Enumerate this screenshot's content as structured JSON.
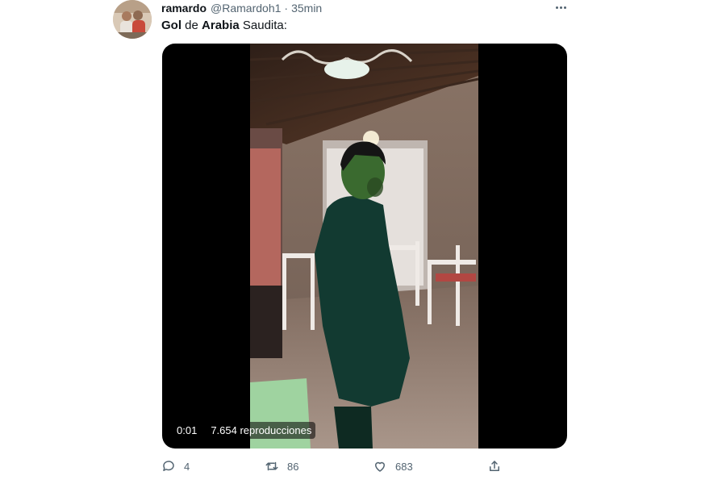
{
  "tweet": {
    "author_name": "ramardo",
    "handle": "@Ramardoh1",
    "separator": "·",
    "time": "35min",
    "text_parts": {
      "word1": "Gol",
      "word2": "de",
      "word3": "Arabia",
      "word4": "Saudita:"
    }
  },
  "video": {
    "elapsed": "0:01",
    "views": "7.654 reproducciones"
  },
  "actions": {
    "reply_count": "4",
    "retweet_count": "86",
    "like_count": "683"
  },
  "icons": {
    "more": "more-icon",
    "reply": "reply-icon",
    "retweet": "retweet-icon",
    "like": "like-icon",
    "share": "share-icon"
  },
  "colors": {
    "text_primary": "#0f1419",
    "text_secondary": "#536471",
    "media_background": "#000000"
  }
}
